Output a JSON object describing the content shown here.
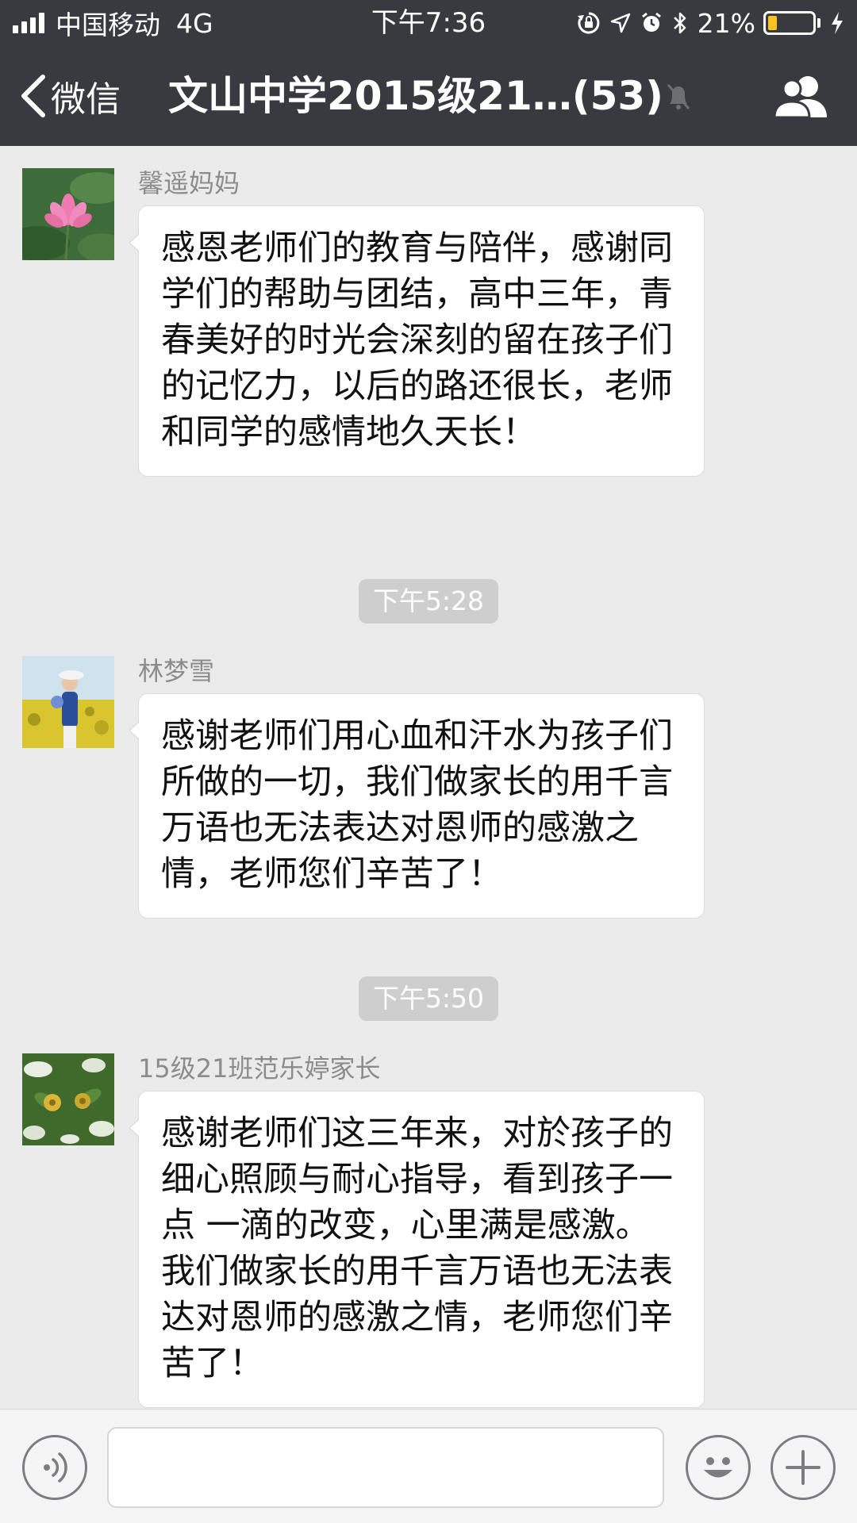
{
  "status_bar": {
    "carrier": "中国移动",
    "network": "4G",
    "time": "下午7:36",
    "battery_percent": "21%",
    "battery_level": 0.21,
    "signal_bars": 4,
    "icons": [
      "rotation-lock-icon",
      "location-icon",
      "alarm-icon",
      "bluetooth-icon",
      "battery-icon",
      "charging-icon"
    ]
  },
  "nav": {
    "back_label": "微信",
    "title": "文山中学2015级21…(53)",
    "icons": [
      "back-chevron-icon",
      "mute-bell-icon",
      "group-members-icon"
    ]
  },
  "messages": [
    {
      "sender": "馨遥妈妈",
      "avatar": "lotus-flower-avatar",
      "text": "感恩老师们的教育与陪伴，感谢同学们的帮助与团结，高中三年，青春美好的时光会深刻的留在孩子们的记忆力，以后的路还很长，老师和同学的感情地久天长！"
    },
    {
      "sender": "林梦雪",
      "avatar": "woman-in-flower-field-avatar",
      "text": "感谢老师们用心血和汗水为孩子们所做的一切，我们做家长的用千言万语也无法表达对恩师的感激之情，老师您们辛苦了！"
    },
    {
      "sender": "15级21班范乐婷家长",
      "avatar": "yellow-flowers-avatar",
      "text": "感谢老师们这三年来，对於孩子的细心照顾与耐心指导，看到孩子一点 一滴的改变，心里满是感激。我们做家长的用千言万语也无法表达对恩师的感激之情，老师您们辛苦了！"
    }
  ],
  "timestamps": [
    "下午5:28",
    "下午5:50"
  ],
  "input_bar": {
    "value": "",
    "icons": [
      "voice-icon",
      "emoji-icon",
      "plus-icon"
    ]
  },
  "colors": {
    "header_bg": "#383a3f",
    "chat_bg": "#ebebeb",
    "bubble_bg": "#ffffff",
    "timestamp_bg": "#cecece",
    "battery_fill": "#f7c41f"
  }
}
